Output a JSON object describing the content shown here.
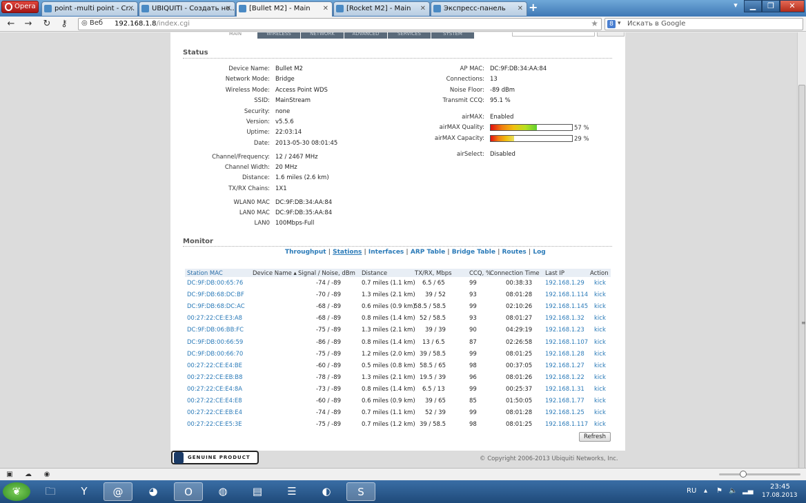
{
  "browser": {
    "opera_label": "Opera",
    "tabs": [
      {
        "label": "point -multi point - Cr..."
      },
      {
        "label": "UBIQUITI - Создать но..."
      },
      {
        "label": "[Bullet M2] - Main"
      },
      {
        "label": "[Rocket M2] - Main"
      },
      {
        "label": "Экспресс-панель"
      }
    ],
    "address": {
      "badge": "Веб",
      "url_host": "192.168.1.8",
      "url_path": "/index.cgi"
    },
    "search_placeholder": "Искать в Google"
  },
  "page": {
    "nav_tabs": [
      "MAIN",
      "WIRELESS",
      "NETWORK",
      "ADVANCED",
      "SERVICES",
      "SYSTEM"
    ],
    "status": {
      "title": "Status",
      "left": [
        {
          "k": "Device Name:",
          "v": "Bullet M2"
        },
        {
          "k": "Network Mode:",
          "v": "Bridge"
        },
        {
          "k": "Wireless Mode:",
          "v": "Access Point WDS"
        },
        {
          "k": "SSID:",
          "v": "MainStream"
        },
        {
          "k": "Security:",
          "v": "none"
        },
        {
          "k": "Version:",
          "v": "v5.5.6"
        },
        {
          "k": "Uptime:",
          "v": "22:03:14"
        },
        {
          "k": "Date:",
          "v": "2013-05-30 08:01:45"
        },
        {
          "k": "Channel/Frequency:",
          "v": "12 / 2467 MHz"
        },
        {
          "k": "Channel Width:",
          "v": "20 MHz"
        },
        {
          "k": "Distance:",
          "v": "1.6 miles (2.6 km)"
        },
        {
          "k": "TX/RX Chains:",
          "v": "1X1"
        },
        {
          "k": "WLAN0 MAC",
          "v": "DC:9F:DB:34:AA:84"
        },
        {
          "k": "LAN0 MAC",
          "v": "DC:9F:DB:35:AA:84"
        },
        {
          "k": "LAN0",
          "v": "100Mbps-Full"
        }
      ],
      "right": [
        {
          "k": "AP MAC:",
          "v": "DC:9F:DB:34:AA:84"
        },
        {
          "k": "Connections:",
          "v": "13"
        },
        {
          "k": "Noise Floor:",
          "v": "-89 dBm"
        },
        {
          "k": "Transmit CCQ:",
          "v": "95.1 %"
        },
        {
          "k": "airMAX:",
          "v": "Enabled"
        },
        {
          "k": "airMAX Quality:",
          "v": ""
        },
        {
          "k": "airMAX Capacity:",
          "v": ""
        },
        {
          "k": "airSelect:",
          "v": "Disabled"
        }
      ],
      "airmax_quality_pct": "57 %",
      "airmax_quality_value": 57,
      "airmax_capacity_pct": "29 %",
      "airmax_capacity_value": 29
    },
    "monitor": {
      "title": "Monitor",
      "links": [
        "Throughput",
        "Stations",
        "Interfaces",
        "ARP Table",
        "Bridge Table",
        "Routes",
        "Log"
      ],
      "columns": [
        "Station MAC",
        "Device Name",
        "Signal / Noise, dBm",
        "Distance",
        "TX/RX, Mbps",
        "CCQ, %",
        "Connection Time",
        "Last IP",
        "Action"
      ],
      "rows": [
        [
          "DC:9F:DB:00:65:76",
          "",
          "-74 / -89",
          "0.7 miles (1.1 km)",
          "6.5 / 65",
          "99",
          "00:38:33",
          "192.168.1.29",
          "kick"
        ],
        [
          "DC:9F:DB:68:DC:BF",
          "",
          "-70 / -89",
          "1.3 miles (2.1 km)",
          "39 / 52",
          "93",
          "08:01:28",
          "192.168.1.114",
          "kick"
        ],
        [
          "DC:9F:DB:68:DC:AC",
          "",
          "-68 / -89",
          "0.6 miles (0.9 km)",
          "58.5 / 58.5",
          "99",
          "02:10:26",
          "192.168.1.145",
          "kick"
        ],
        [
          "00:27:22:CE:E3:A8",
          "",
          "-68 / -89",
          "0.8 miles (1.4 km)",
          "52 / 58.5",
          "93",
          "08:01:27",
          "192.168.1.32",
          "kick"
        ],
        [
          "DC:9F:DB:06:BB:FC",
          "",
          "-75 / -89",
          "1.3 miles (2.1 km)",
          "39 / 39",
          "90",
          "04:29:19",
          "192.168.1.23",
          "kick"
        ],
        [
          "DC:9F:DB:00:66:59",
          "",
          "-86 / -89",
          "0.8 miles (1.4 km)",
          "13 / 6.5",
          "87",
          "02:26:58",
          "192.168.1.107",
          "kick"
        ],
        [
          "DC:9F:DB:00:66:70",
          "",
          "-75 / -89",
          "1.2 miles (2.0 km)",
          "39 / 58.5",
          "99",
          "08:01:25",
          "192.168.1.28",
          "kick"
        ],
        [
          "00:27:22:CE:E4:BE",
          "",
          "-60 / -89",
          "0.5 miles (0.8 km)",
          "58.5 / 65",
          "98",
          "00:37:05",
          "192.168.1.27",
          "kick"
        ],
        [
          "00:27:22:CE:EB:B8",
          "",
          "-78 / -89",
          "1.3 miles (2.1 km)",
          "19.5 / 39",
          "96",
          "08:01:26",
          "192.168.1.22",
          "kick"
        ],
        [
          "00:27:22:CE:E4:8A",
          "",
          "-73 / -89",
          "0.8 miles (1.4 km)",
          "6.5 / 13",
          "99",
          "00:25:37",
          "192.168.1.31",
          "kick"
        ],
        [
          "00:27:22:CE:E4:E8",
          "",
          "-60 / -89",
          "0.6 miles (0.9 km)",
          "39 / 65",
          "85",
          "01:50:05",
          "192.168.1.77",
          "kick"
        ],
        [
          "00:27:22:CE:EB:E4",
          "",
          "-74 / -89",
          "0.7 miles (1.1 km)",
          "52 / 39",
          "99",
          "08:01:28",
          "192.168.1.25",
          "kick"
        ],
        [
          "00:27:22:CE:E5:3E",
          "",
          "-75 / -89",
          "0.7 miles (1.2 km)",
          "39 / 58.5",
          "98",
          "08:01:25",
          "192.168.1.117",
          "kick"
        ]
      ],
      "refresh_label": "Refresh"
    },
    "genuine_label": "GENUINE PRODUCT",
    "copyright": "© Copyright 2006-2013 Ubiquiti Networks, Inc."
  },
  "taskbar": {
    "lang": "RU",
    "time": "23:45",
    "date": "17.08.2013"
  }
}
